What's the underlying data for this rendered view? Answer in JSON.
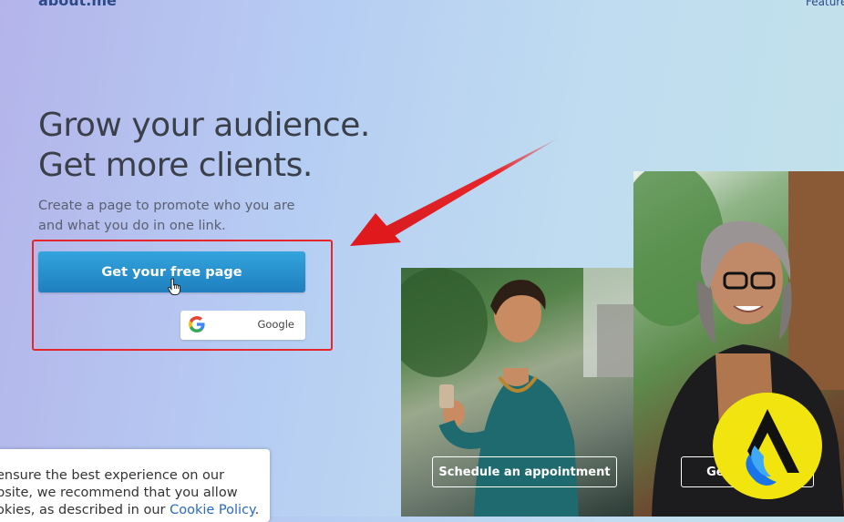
{
  "header": {
    "logo_text": "about.me",
    "nav_features": "Features"
  },
  "hero": {
    "headline_line1": "Grow your audience.",
    "headline_line2": "Get more clients.",
    "subtitle_line1": "Create a page to promote who you are",
    "subtitle_line2": "and what you do in one link.",
    "cta_label": "Get your free page",
    "google_label": "Google"
  },
  "cards": {
    "card1_button": "Schedule an appointment",
    "card2_button": "Get in touch"
  },
  "cookie": {
    "line1": "ensure the best experience on our",
    "line2": "bsite, we recommend that you allow",
    "line3_prefix": "okies, as described in our ",
    "link": "Cookie Policy",
    "line3_suffix": "."
  },
  "colors": {
    "accent": "#2a8fcf",
    "annotation": "#e8262a",
    "badge": "#f2e40e"
  },
  "icons": [
    "google-g-icon",
    "hand-cursor-icon",
    "red-arrow-annotation",
    "brand-badge-icon"
  ]
}
